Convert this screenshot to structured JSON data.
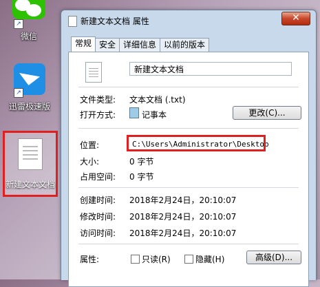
{
  "desktop": {
    "icons": [
      {
        "label": "微信"
      },
      {
        "label": "迅雷极速版"
      },
      {
        "label": "新建文本文档"
      }
    ]
  },
  "window": {
    "title": "新建文本文档 属性",
    "close_symbol": "✕",
    "tabs": [
      {
        "label": "常规"
      },
      {
        "label": "安全"
      },
      {
        "label": "详细信息"
      },
      {
        "label": "以前的版本"
      }
    ],
    "file_name": "新建文本文档",
    "file_type_label": "文件类型:",
    "file_type_value": "文本文档 (.txt)",
    "open_with_label": "打开方式:",
    "open_with_value": "记事本",
    "change_button": "更改(C)...",
    "location_label": "位置:",
    "location_value": "C:\\Users\\Administrator\\Desktop",
    "size_label": "大小:",
    "size_value": "0 字节",
    "disk_size_label": "占用空间:",
    "disk_size_value": "0 字节",
    "created_label": "创建时间:",
    "created_value": "2018年2月24日，20:10:07",
    "modified_label": "修改时间:",
    "modified_value": "2018年2月24日，20:10:07",
    "accessed_label": "访问时间:",
    "accessed_value": "2018年2月24日，20:10:07",
    "attributes_label": "属性:",
    "readonly_label": "只读(R)",
    "hidden_label": "隐藏(H)",
    "advanced_button": "高级(D)...",
    "highlight_color": "#e02020"
  }
}
